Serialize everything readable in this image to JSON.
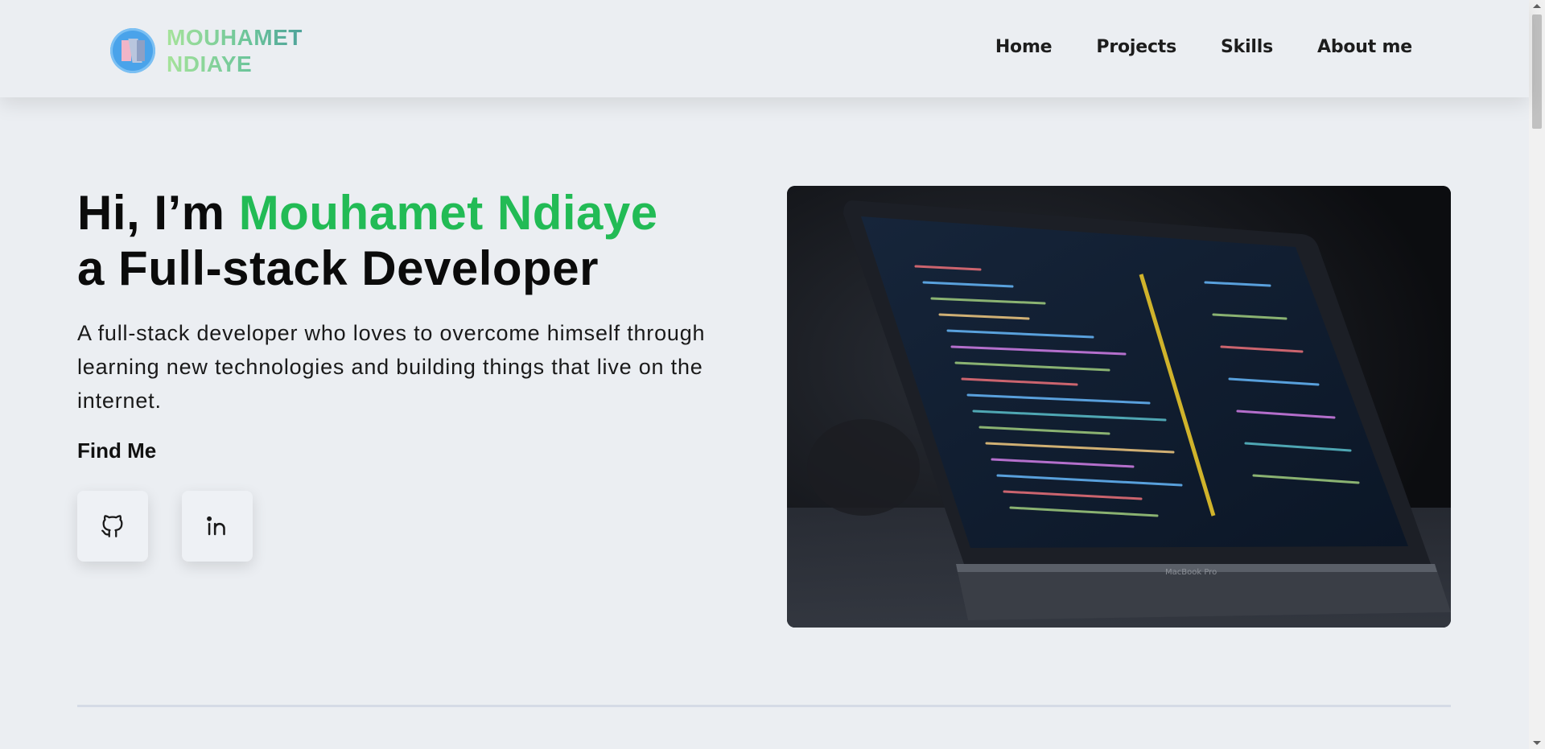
{
  "brand": {
    "line1": "MOUHAMET",
    "line2": "NDIAYE",
    "logo_icon": "m-monogram-logo"
  },
  "nav": {
    "items": [
      {
        "label": "Home"
      },
      {
        "label": "Projects"
      },
      {
        "label": "Skills"
      },
      {
        "label": "About me"
      }
    ]
  },
  "hero": {
    "greeting": "Hi, I’m ",
    "name": "Mouhamet Ndiaye",
    "role": "a Full-stack Developer",
    "description": "A full-stack developer who loves to overcome himself through learning new technologies and building things that live on the internet.",
    "find_me": "Find Me",
    "social": [
      {
        "icon": "github-icon"
      },
      {
        "icon": "linkedin-icon"
      }
    ],
    "image_alt": "laptop-with-code-editor",
    "image_text": "MacBook Pro"
  },
  "colors": {
    "accent": "#22bb55",
    "background": "#ebeef2",
    "text": "#111111"
  }
}
